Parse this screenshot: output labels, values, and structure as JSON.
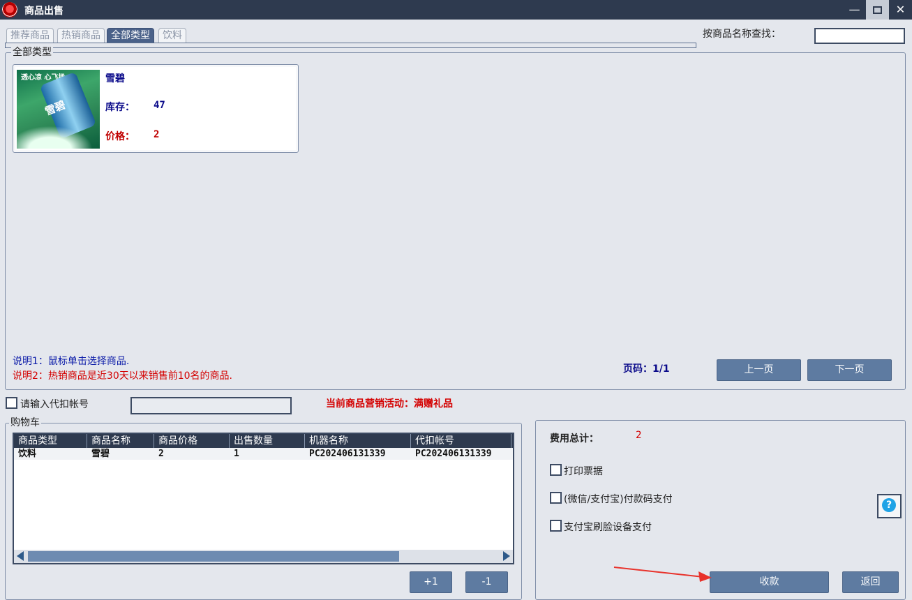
{
  "window": {
    "title": "商品出售",
    "minimize": "—",
    "close": "✕"
  },
  "tabs": [
    "推荐商品",
    "热销商品",
    "全部类型",
    "饮料"
  ],
  "search": {
    "label": "按商品名称查找：",
    "value": ""
  },
  "category_panel": {
    "legend": "全部类型"
  },
  "product": {
    "name": "雪碧",
    "stock_label": "库存：",
    "stock": "47",
    "price_label": "价格：",
    "price": "2",
    "image_text": "雪碧",
    "slogan": "透心凉 心飞扬"
  },
  "notes": {
    "note1": "说明1：鼠标单击选择商品.",
    "note2": "说明2：热销商品是近30天以来销售前10名的商品."
  },
  "pagination": {
    "page_info": "页码：1/1",
    "prev": "上一页",
    "next": "下一页"
  },
  "account": {
    "checkbox_label": "请输入代扣帐号",
    "value": ""
  },
  "promotion": "当前商品营销活动：满赠礼品",
  "cart": {
    "legend": "购物车",
    "columns": [
      "商品类型",
      "商品名称",
      "商品价格",
      "出售数量",
      "机器名称",
      "代扣帐号"
    ],
    "rows": [
      [
        "饮料",
        "雪碧",
        "2",
        "1",
        "PC202406131339",
        "PC202406131339"
      ]
    ],
    "plus": "+1",
    "minus": "-1"
  },
  "payment": {
    "total_label": "费用总计：",
    "total": "2",
    "options": [
      "打印票据",
      "(微信/支付宝)付款码支付",
      "支付宝刷脸设备支付"
    ],
    "help": "?",
    "collect": "收款",
    "back": "返回"
  },
  "colors": {
    "titlebar": "#2e3a4f",
    "button": "#5e7ba1",
    "accent_red": "#d40000",
    "accent_blue": "#0a0a8a"
  }
}
